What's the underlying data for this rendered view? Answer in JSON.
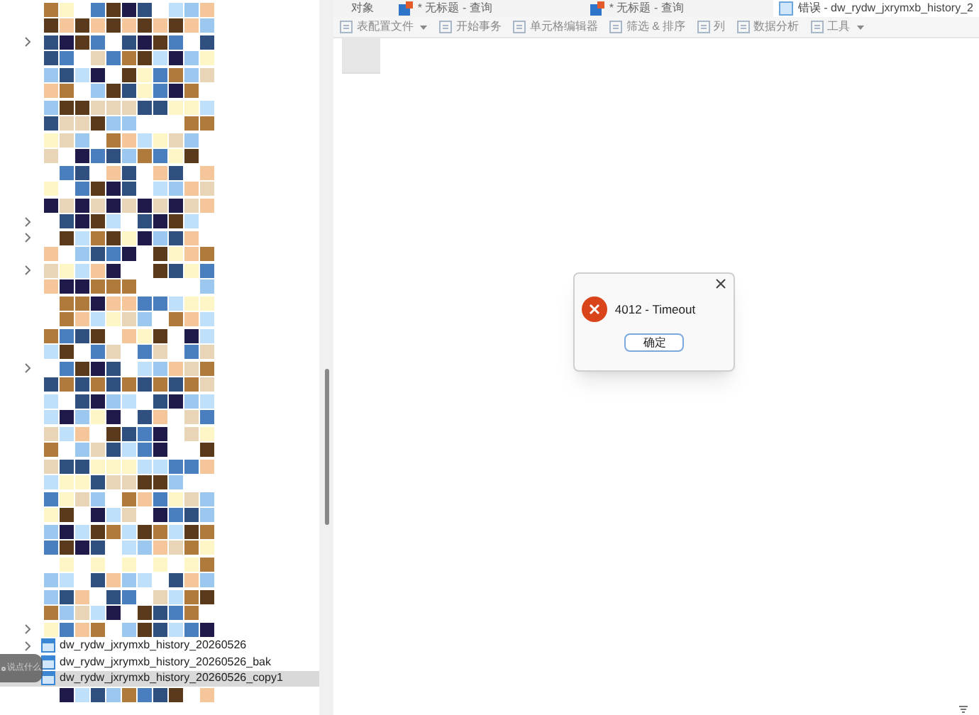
{
  "tabs": [
    {
      "label": "对象",
      "kind": "plain",
      "selected": false
    },
    {
      "label": "* 无标题 - 查询",
      "kind": "query",
      "selected": false
    },
    {
      "label": "* 无标题 - 查询",
      "kind": "query",
      "selected": false
    },
    {
      "label": "错误 - dw_rydw_jxrymxb_history_2",
      "kind": "table",
      "selected": true
    }
  ],
  "toolbar": [
    {
      "label": "表配置文件",
      "dropdown": true
    },
    {
      "label": "开始事务",
      "dropdown": false
    },
    {
      "label": "单元格编辑器",
      "dropdown": false
    },
    {
      "label": "筛选 & 排序",
      "dropdown": false
    },
    {
      "label": "列",
      "dropdown": false
    },
    {
      "label": "数据分析",
      "dropdown": false
    },
    {
      "label": "工具",
      "dropdown": true
    }
  ],
  "tree": [
    {
      "kind": "masked",
      "expandable": false
    },
    {
      "kind": "masked",
      "expandable": false
    },
    {
      "kind": "masked",
      "expandable": true
    },
    {
      "kind": "masked",
      "expandable": false
    },
    {
      "kind": "masked",
      "expandable": false
    },
    {
      "kind": "masked",
      "expandable": false
    },
    {
      "kind": "masked",
      "expandable": false
    },
    {
      "kind": "masked",
      "expandable": false
    },
    {
      "kind": "masked",
      "expandable": false
    },
    {
      "kind": "masked",
      "expandable": false
    },
    {
      "kind": "masked",
      "expandable": false
    },
    {
      "kind": "masked",
      "expandable": false
    },
    {
      "kind": "masked",
      "expandable": false
    },
    {
      "kind": "masked",
      "expandable": true
    },
    {
      "kind": "masked",
      "expandable": true
    },
    {
      "kind": "masked",
      "expandable": false
    },
    {
      "kind": "masked",
      "expandable": true
    },
    {
      "kind": "masked",
      "expandable": false
    },
    {
      "kind": "masked",
      "expandable": false
    },
    {
      "kind": "masked",
      "expandable": false
    },
    {
      "kind": "masked",
      "expandable": false
    },
    {
      "kind": "masked",
      "expandable": false
    },
    {
      "kind": "masked",
      "expandable": true
    },
    {
      "kind": "masked",
      "expandable": false
    },
    {
      "kind": "masked",
      "expandable": false
    },
    {
      "kind": "masked",
      "expandable": false
    },
    {
      "kind": "masked",
      "expandable": false
    },
    {
      "kind": "masked",
      "expandable": false
    },
    {
      "kind": "masked",
      "expandable": false
    },
    {
      "kind": "masked",
      "expandable": false
    },
    {
      "kind": "masked",
      "expandable": false
    },
    {
      "kind": "masked",
      "expandable": false
    },
    {
      "kind": "masked",
      "expandable": false
    },
    {
      "kind": "masked",
      "expandable": false
    },
    {
      "kind": "masked",
      "expandable": false
    },
    {
      "kind": "masked",
      "expandable": false
    },
    {
      "kind": "masked",
      "expandable": false
    },
    {
      "kind": "masked",
      "expandable": false
    },
    {
      "kind": "masked",
      "expandable": true
    },
    {
      "kind": "table",
      "label": "dw_rydw_jxrymxb_history_20260526",
      "expandable": true,
      "selected": false
    },
    {
      "kind": "table",
      "label": "dw_rydw_jxrymxb_history_20260526_bak",
      "expandable": false,
      "selected": false
    },
    {
      "kind": "table",
      "label": "dw_rydw_jxrymxb_history_20260526_copy1",
      "expandable": false,
      "selected": true
    },
    {
      "kind": "masked",
      "expandable": false
    }
  ],
  "comment_box": {
    "placeholder": "说点什么"
  },
  "dialog": {
    "message": "4012 - Timeout",
    "button": "确定"
  }
}
